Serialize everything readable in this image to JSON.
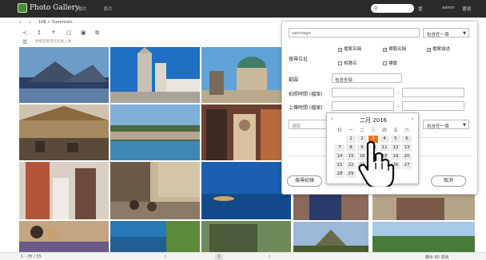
{
  "app": {
    "title": "Photo Gallery",
    "nav": [
      "相片",
      "影片"
    ]
  },
  "topbar": {
    "search_placeholder": "",
    "right_items": [
      "管",
      "admin",
      "選項"
    ]
  },
  "toolbar": {
    "breadcrumb": "108 > Summrain"
  },
  "toolbar3": {
    "hint": "將檔案拖曳至此處上傳"
  },
  "bottombar": {
    "left": "1 - 35 / 35",
    "page": "1",
    "right": "顯示 60 項目"
  },
  "panel": {
    "keyword_value": "samtago",
    "keyword_scope": "包含任一項",
    "search_location_label": "搜尋位址",
    "checkboxes": [
      {
        "label": "檔案名稱",
        "checked": true
      },
      {
        "label": "標籤名稱",
        "checked": true
      },
      {
        "label": "檔案描述",
        "checked": true
      },
      {
        "label": "相簿名",
        "checked": false
      },
      {
        "label": "標籤",
        "checked": false
      }
    ],
    "range_label": "範圍",
    "range_value": "包含全部",
    "taken_time_label": "拍照時間 (檔案)",
    "upload_time_label": "上傳時間 (檔案)",
    "dash": "-",
    "tag_placeholder": "標籤",
    "tag_scope": "包含任一項",
    "save_button": "搜尋紀錄",
    "cancel_button": "取消"
  },
  "calendar": {
    "title": "二月 2016",
    "prev": "‹",
    "next": "›",
    "dow": [
      "日",
      "一",
      "二",
      "三",
      "四",
      "五",
      "六"
    ],
    "weeks": [
      [
        "",
        "1",
        "2",
        "3",
        "4",
        "5",
        "6"
      ],
      [
        "7",
        "8",
        "9",
        "10",
        "11",
        "12",
        "13"
      ],
      [
        "14",
        "15",
        "16",
        "17",
        "18",
        "19",
        "20"
      ],
      [
        "21",
        "22",
        "23",
        "24",
        "25",
        "26",
        "27"
      ],
      [
        "28",
        "29",
        "",
        "",
        "",
        "",
        ""
      ]
    ],
    "selected_day": "3"
  },
  "colors": {
    "topbar": "#2b2b2b",
    "accent": "#e8741c"
  }
}
